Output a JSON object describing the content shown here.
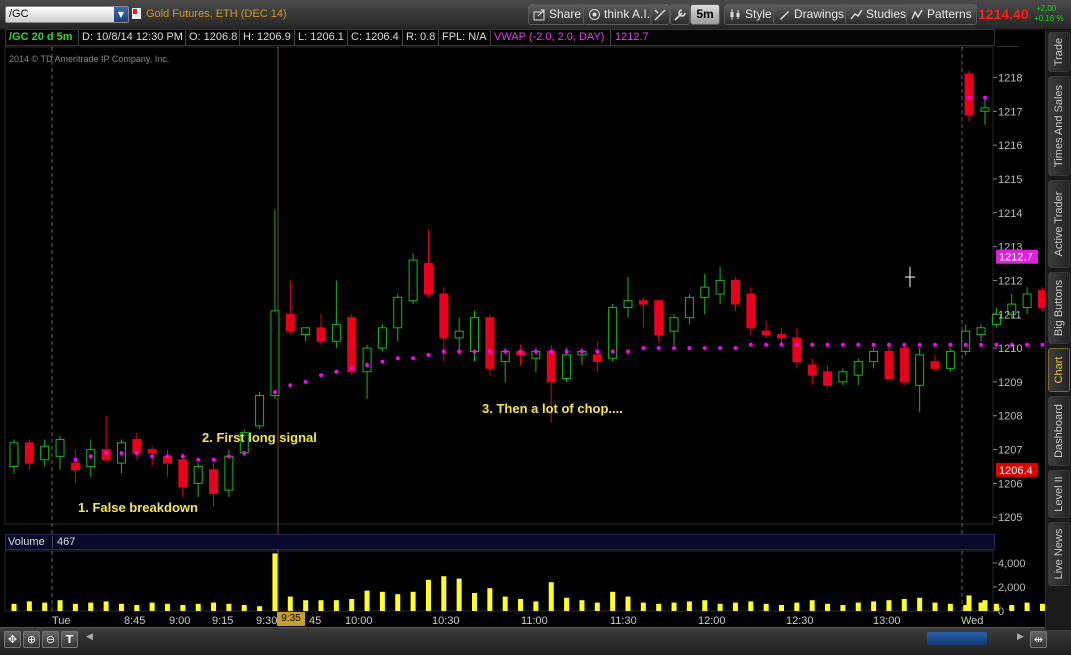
{
  "toolbar": {
    "symbol": "/GC",
    "description": "Gold Futures, ETH (DEC 14)",
    "buttons": {
      "share": "Share",
      "think": "think A.I.",
      "timeframe": "5m",
      "style": "Style",
      "drawings": "Drawings",
      "studies": "Studies",
      "patterns": "Patterns"
    },
    "last_price": "1214.40",
    "change_abs": "+2.00",
    "change_pct": "+0.16 %"
  },
  "infobar": {
    "period": "/GC 20 d 5m",
    "date": "D: 10/8/14 12:30 PM",
    "open": "O: 1206.8",
    "high": "H: 1206.9",
    "low": "L: 1206.1",
    "close": "C: 1206.4",
    "range": "R: 0.8",
    "fpl": "FPL: N/A",
    "study": "VWAP (-2.0, 2.0, DAY)",
    "study_value": "1212.7"
  },
  "copyright": "2014 © TD Ameritrade IP Company, Inc.",
  "annotations": {
    "a1": "1. False breakdown",
    "a2": "2. First long signal",
    "a3": "3. Then a lot of chop...."
  },
  "volume_panel": {
    "label": "Volume",
    "value": "467",
    "ticks": [
      "4,000",
      "2,000",
      "0"
    ]
  },
  "price_axis": {
    "ticks": [
      "1218",
      "1217",
      "1216",
      "1215",
      "1214",
      "1213",
      "1212",
      "1211",
      "1210",
      "1209",
      "1208",
      "1207",
      "1206",
      "1205"
    ],
    "vwap_marker": "1212.7",
    "last_marker": "1206.4"
  },
  "time_axis": {
    "labels": [
      "Tue",
      "8:45",
      "9:00",
      "9:15",
      "9:30",
      "45",
      "10:00",
      "10:30",
      "11:00",
      "11:30",
      "12:00",
      "12:30",
      "13:00",
      "Wed"
    ],
    "cursor": "9:35"
  },
  "right_tabs": [
    "Trade",
    "Times And Sales",
    "Active Trader",
    "Big Buttons",
    "Chart",
    "Dashboard",
    "Level II",
    "Live News"
  ],
  "colors": {
    "up": "#1bb81b",
    "down": "#e8001c",
    "vwap": "#ff00ff",
    "volume": "#ffff28",
    "accent": "#c8a028"
  },
  "chart_data": {
    "type": "candlestick",
    "y_range": [
      1205,
      1218
    ],
    "x_labels": [
      "Tue",
      "8:45",
      "9:00",
      "9:15",
      "9:30",
      "45",
      "10:00",
      "10:30",
      "11:00",
      "11:30",
      "12:00",
      "12:30",
      "13:00",
      "Wed"
    ],
    "candles": [
      [
        1206.5,
        1207.3,
        1206.3,
        1207.2
      ],
      [
        1207.2,
        1207.3,
        1206.4,
        1206.6
      ],
      [
        1206.7,
        1207.3,
        1206.5,
        1207.1
      ],
      [
        1206.8,
        1207.4,
        1206.4,
        1207.3
      ],
      [
        1206.6,
        1207.0,
        1206.0,
        1206.4
      ],
      [
        1206.5,
        1207.3,
        1206.2,
        1207.0
      ],
      [
        1207.0,
        1208.0,
        1206.6,
        1206.7
      ],
      [
        1206.6,
        1207.3,
        1206.3,
        1207.2
      ],
      [
        1207.3,
        1207.5,
        1206.7,
        1206.9
      ],
      [
        1207.0,
        1207.1,
        1206.5,
        1206.9
      ],
      [
        1206.8,
        1207.0,
        1206.2,
        1206.6
      ],
      [
        1206.7,
        1206.9,
        1205.6,
        1205.9
      ],
      [
        1206.0,
        1206.6,
        1205.6,
        1206.5
      ],
      [
        1206.4,
        1206.6,
        1205.3,
        1205.7
      ],
      [
        1205.8,
        1207.0,
        1205.6,
        1206.8
      ],
      [
        1206.9,
        1207.6,
        1206.8,
        1207.5
      ],
      [
        1207.7,
        1208.7,
        1207.6,
        1208.6
      ],
      [
        1208.6,
        1214.1,
        1208.5,
        1211.1
      ],
      [
        1211.0,
        1212.0,
        1210.4,
        1210.5
      ],
      [
        1210.4,
        1210.6,
        1210.2,
        1210.6
      ],
      [
        1210.6,
        1211.0,
        1210.1,
        1210.2
      ],
      [
        1210.2,
        1212.0,
        1210.0,
        1210.7
      ],
      [
        1210.9,
        1211.0,
        1209.2,
        1209.3
      ],
      [
        1209.3,
        1210.1,
        1208.5,
        1210.0
      ],
      [
        1210.0,
        1210.7,
        1209.9,
        1210.6
      ],
      [
        1210.6,
        1211.6,
        1210.2,
        1211.5
      ],
      [
        1211.4,
        1212.8,
        1211.3,
        1212.6
      ],
      [
        1212.5,
        1213.5,
        1211.5,
        1211.6
      ],
      [
        1211.6,
        1211.8,
        1209.6,
        1210.3
      ],
      [
        1210.3,
        1210.9,
        1209.9,
        1210.5
      ],
      [
        1209.9,
        1211.1,
        1209.6,
        1210.9
      ],
      [
        1210.9,
        1211.0,
        1209.2,
        1209.4
      ],
      [
        1209.6,
        1210.0,
        1209.0,
        1209.9
      ],
      [
        1209.9,
        1210.1,
        1209.5,
        1209.8
      ],
      [
        1209.7,
        1210.0,
        1209.3,
        1209.9
      ],
      [
        1209.9,
        1210.1,
        1207.8,
        1209.0
      ],
      [
        1209.1,
        1210.0,
        1209.0,
        1209.8
      ],
      [
        1209.8,
        1210.0,
        1209.5,
        1209.9
      ],
      [
        1209.8,
        1210.2,
        1209.3,
        1209.6
      ],
      [
        1209.7,
        1211.3,
        1209.6,
        1211.2
      ],
      [
        1211.2,
        1212.1,
        1210.9,
        1211.4
      ],
      [
        1211.4,
        1211.5,
        1210.6,
        1211.3
      ],
      [
        1211.4,
        1211.4,
        1210.2,
        1210.4
      ],
      [
        1210.5,
        1211.0,
        1210.0,
        1210.9
      ],
      [
        1210.9,
        1211.6,
        1210.7,
        1211.5
      ],
      [
        1211.5,
        1212.2,
        1211.0,
        1211.8
      ],
      [
        1211.6,
        1212.4,
        1211.3,
        1212.0
      ],
      [
        1212.0,
        1212.1,
        1211.1,
        1211.3
      ],
      [
        1211.6,
        1211.8,
        1210.4,
        1210.6
      ],
      [
        1210.5,
        1210.8,
        1210.3,
        1210.4
      ],
      [
        1210.4,
        1210.6,
        1210.1,
        1210.3
      ],
      [
        1210.3,
        1210.6,
        1209.4,
        1209.6
      ],
      [
        1209.5,
        1209.7,
        1208.9,
        1209.2
      ],
      [
        1209.3,
        1209.5,
        1208.8,
        1208.9
      ],
      [
        1209.0,
        1209.4,
        1208.9,
        1209.3
      ],
      [
        1209.2,
        1209.7,
        1208.9,
        1209.6
      ],
      [
        1209.6,
        1210.0,
        1209.4,
        1209.9
      ],
      [
        1209.9,
        1210.1,
        1209.1,
        1209.1
      ],
      [
        1210.0,
        1210.1,
        1208.9,
        1209.0
      ],
      [
        1208.9,
        1210.0,
        1208.1,
        1209.8
      ],
      [
        1209.6,
        1209.8,
        1209.3,
        1209.4
      ],
      [
        1209.4,
        1210.0,
        1209.3,
        1209.9
      ],
      [
        1209.9,
        1210.7,
        1209.8,
        1210.5
      ],
      [
        1210.4,
        1210.7,
        1210.2,
        1210.6
      ],
      [
        1210.7,
        1211.2,
        1210.6,
        1211.0
      ],
      [
        1211.0,
        1211.6,
        1210.9,
        1211.3
      ],
      [
        1211.2,
        1211.8,
        1211.0,
        1211.6
      ],
      [
        1211.7,
        1211.8,
        1211.1,
        1211.2
      ],
      [
        1211.2,
        1212.8,
        1211.0,
        1212.2
      ],
      [
        1212.2,
        1213.3,
        1212.1,
        1212.2
      ],
      [
        1212.2,
        1212.3,
        1211.8,
        1212.0
      ],
      [
        1211.9,
        1212.1,
        1211.5,
        1212.1
      ],
      [
        1212.1,
        1212.9,
        1211.8,
        1212.4
      ],
      [
        1218.1,
        1218.2,
        1216.7,
        1216.9
      ],
      [
        1217.0,
        1217.4,
        1216.6,
        1217.1
      ]
    ],
    "vwap": [
      null,
      null,
      null,
      null,
      1206.7,
      1206.8,
      1206.9,
      1206.9,
      1206.9,
      1206.8,
      1206.8,
      1206.8,
      1206.7,
      1206.7,
      1206.8,
      1206.9,
      null,
      1208.7,
      1208.9,
      1209.0,
      1209.2,
      1209.3,
      1209.4,
      1209.5,
      1209.6,
      1209.7,
      1209.7,
      1209.8,
      1209.9,
      1209.9,
      1209.9,
      1209.9,
      1209.9,
      1209.9,
      1209.9,
      1209.9,
      1209.9,
      1209.9,
      1209.9,
      1209.9,
      1209.9,
      1210.0,
      1210.0,
      1210.0,
      1210.0,
      1210.0,
      1210.0,
      1210.0,
      1210.1,
      1210.1,
      1210.1,
      1210.1,
      1210.1,
      1210.1,
      1210.1,
      1210.1,
      1210.1,
      1210.1,
      1210.1,
      1210.1,
      1210.1,
      1210.1,
      1210.1,
      1210.1,
      1210.1,
      1210.1,
      1210.1,
      1210.1,
      1210.1,
      1210.1,
      1210.2,
      1210.2,
      1210.2,
      1217.4,
      1217.4
    ],
    "volume": [
      600,
      800,
      700,
      900,
      600,
      700,
      800,
      600,
      500,
      700,
      600,
      500,
      600,
      700,
      600,
      500,
      400,
      4800,
      1200,
      900,
      900,
      900,
      1000,
      1700,
      1600,
      1400,
      1600,
      2600,
      2900,
      2700,
      1500,
      1900,
      1200,
      1000,
      800,
      2400,
      1100,
      900,
      700,
      1600,
      1200,
      700,
      600,
      700,
      800,
      900,
      600,
      700,
      800,
      600,
      500,
      700,
      900,
      600,
      500,
      700,
      800,
      900,
      1000,
      1100,
      700,
      600,
      500,
      700,
      600,
      500,
      700,
      600,
      800,
      700,
      600,
      700,
      600,
      1300,
      900
    ],
    "volume_range": [
      0,
      5000
    ]
  }
}
